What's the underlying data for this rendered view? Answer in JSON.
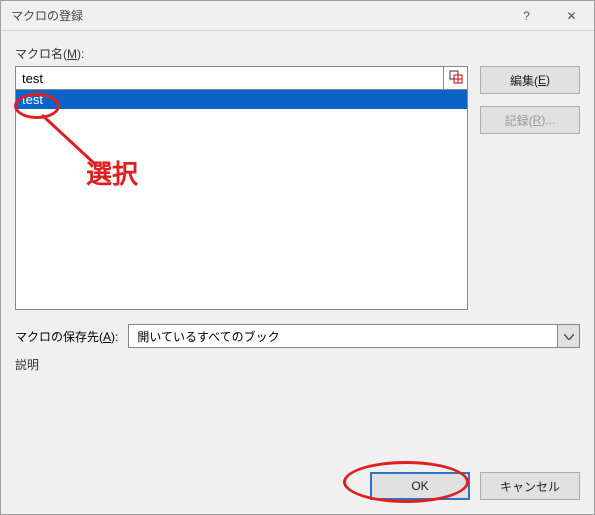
{
  "titlebar": {
    "title": "マクロの登録"
  },
  "labels": {
    "macroName": "マクロ名(",
    "macroNameKey": "M",
    "macroNameAfter": "):",
    "storeIn": "マクロの保存先(",
    "storeInKey": "A",
    "storeInAfter": "):",
    "description": "説明"
  },
  "macro": {
    "name_value": "test",
    "list": [
      {
        "label": "test",
        "selected": true
      }
    ]
  },
  "storeIn": {
    "selected": "開いているすべてのブック"
  },
  "buttons": {
    "edit": "編集(",
    "editKey": "E",
    "editAfter": ")",
    "record": "記録(",
    "recordKey": "R",
    "recordAfter": ")...",
    "ok": "OK",
    "cancel": "キャンセル"
  },
  "annotation": {
    "label": "選択"
  }
}
